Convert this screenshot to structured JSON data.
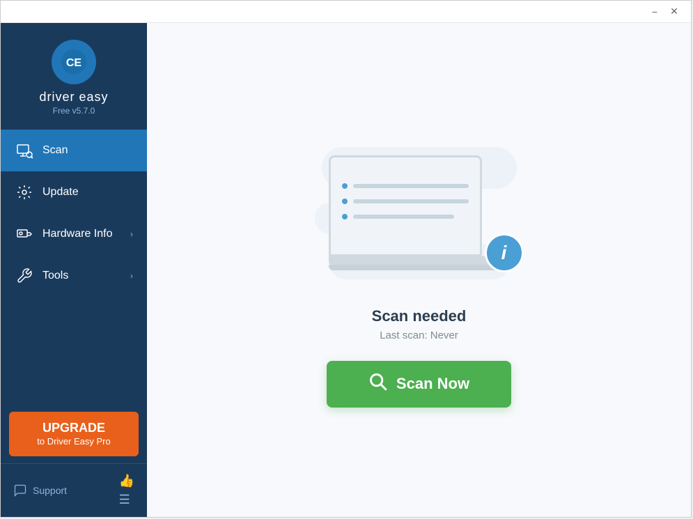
{
  "window": {
    "title": "Driver Easy",
    "minimize_label": "−",
    "close_label": "✕"
  },
  "sidebar": {
    "logo_text1": "driver easy",
    "logo_version": "Free v5.7.0",
    "nav": [
      {
        "id": "scan",
        "label": "Scan",
        "active": true,
        "has_arrow": false
      },
      {
        "id": "update",
        "label": "Update",
        "active": false,
        "has_arrow": false
      },
      {
        "id": "hardware",
        "label": "Hardware Info",
        "active": false,
        "has_arrow": true
      },
      {
        "id": "tools",
        "label": "Tools",
        "active": false,
        "has_arrow": true
      }
    ],
    "upgrade_line1": "UPGRADE",
    "upgrade_line2": "to Driver Easy Pro",
    "support_label": "Support",
    "thumbs_icon": "👍",
    "menu_icon": "☰"
  },
  "content": {
    "scan_title": "Scan needed",
    "scan_subtitle": "Last scan: Never",
    "scan_button_label": "Scan Now",
    "info_icon": "i"
  }
}
